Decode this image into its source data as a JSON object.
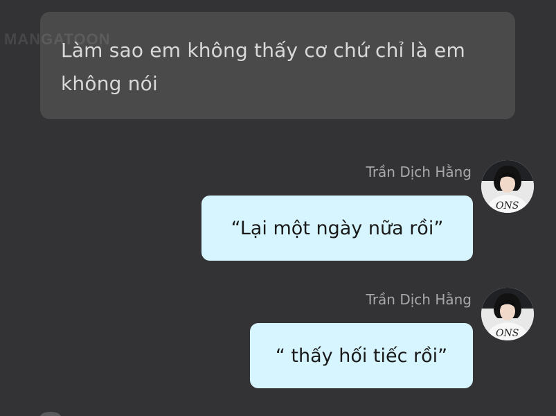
{
  "watermark": "MANGATOON",
  "narration": {
    "text": "Làm sao em không thấy cơ chứ chỉ là em không nói"
  },
  "messages": [
    {
      "sender": "Trần Dịch Hằng",
      "text": "“Lại một ngày nữa rồi”",
      "avatar_icon": "user-avatar-icon"
    },
    {
      "sender": "Trần Dịch Hằng",
      "text": "“ thấy hối tiếc rồi”",
      "avatar_icon": "user-avatar-icon"
    }
  ],
  "colors": {
    "background": "#333335",
    "narration_box": "#4a4a4b",
    "bubble": "#d7f5ff",
    "sender_text": "#a9a9ab"
  }
}
